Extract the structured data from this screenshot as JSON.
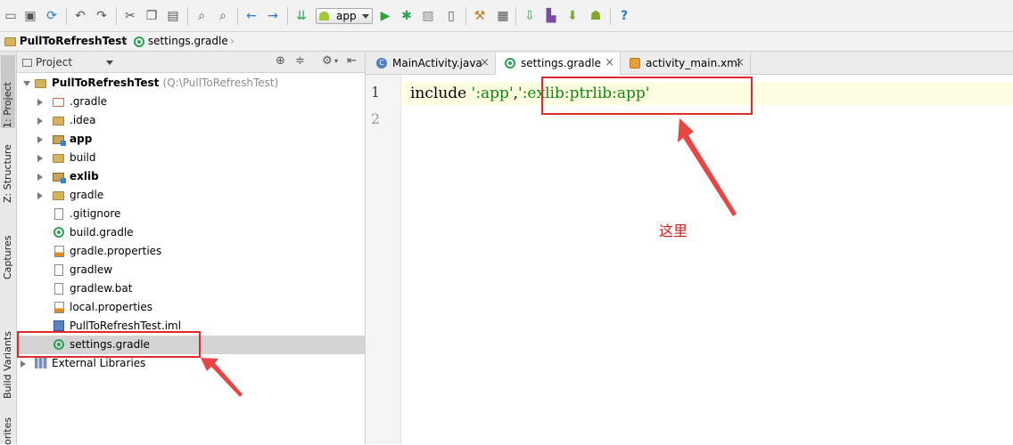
{
  "toolbar": {
    "icons": [
      "open-icon",
      "save-all-icon",
      "sync-icon",
      "undo-icon",
      "redo-icon",
      "cut-icon",
      "copy-icon",
      "paste-icon",
      "find-icon",
      "replace-icon",
      "back-icon",
      "forward-icon",
      "make-project-icon",
      "run-config-icon",
      "run-icon",
      "debug-icon",
      "attach-debugger-icon",
      "run-coverage-icon",
      "project-structure-icon",
      "sdk-manager-icon",
      "avd-manager-icon",
      "sync-gradle-icon",
      "android-monitor-icon",
      "android-device-icon",
      "help-icon"
    ],
    "run_config": "app",
    "help": "?"
  },
  "breadcrumb": {
    "project": "PullToRefreshTest",
    "file": "settings.gradle"
  },
  "side_tabs": {
    "project": "1: Project",
    "structure": "Z: Structure",
    "captures": "Captures",
    "build_variants": "Build Variants",
    "favorites": "orites"
  },
  "project_panel": {
    "view_selector": "Project",
    "root_name": "PullToRefreshTest",
    "root_path": "(Q:\\PullToRefreshTest)",
    "items": [
      {
        "label": ".gradle"
      },
      {
        "label": ".idea"
      },
      {
        "label": "app"
      },
      {
        "label": "build"
      },
      {
        "label": "exlib"
      },
      {
        "label": "gradle"
      },
      {
        "label": ".gitignore"
      },
      {
        "label": "build.gradle"
      },
      {
        "label": "gradle.properties"
      },
      {
        "label": "gradlew"
      },
      {
        "label": "gradlew.bat"
      },
      {
        "label": "local.properties"
      },
      {
        "label": "PullToRefreshTest.iml"
      },
      {
        "label": "settings.gradle"
      },
      {
        "label": "External Libraries"
      }
    ]
  },
  "editor_tabs": [
    {
      "label": "MainActivity.java"
    },
    {
      "label": "settings.gradle"
    },
    {
      "label": "activity_main.xml"
    }
  ],
  "editor": {
    "line_numbers": [
      "1",
      "2"
    ],
    "code": {
      "keyword": "include ",
      "str1": "':app'",
      "comma": ",",
      "str2": "':exlib:ptrlib:app'"
    }
  },
  "annotation": {
    "callout": "这里",
    "color": "#e12b2b"
  }
}
